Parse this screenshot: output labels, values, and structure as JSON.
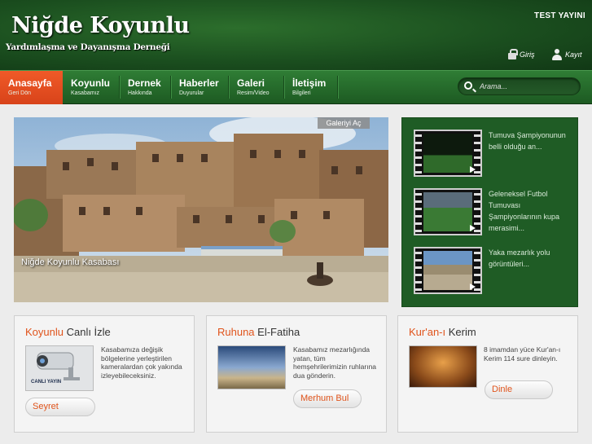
{
  "header": {
    "title": "Niğde Koyunlu",
    "subtitle": "Yardımlaşma ve Dayanışma Derneği",
    "top_right": "TEST YAYINI",
    "login_label": "Giriş",
    "register_label": "Kayıt"
  },
  "nav": {
    "items": [
      {
        "label": "Anasayfa",
        "sub": "Geri Dön"
      },
      {
        "label": "Koyunlu",
        "sub": "Kasabamız"
      },
      {
        "label": "Dernek",
        "sub": "Hakkında"
      },
      {
        "label": "Haberler",
        "sub": "Duyurular"
      },
      {
        "label": "Galeri",
        "sub": "Resim/Video"
      },
      {
        "label": "İletişim",
        "sub": "Bilgileri"
      }
    ],
    "active_index": 0,
    "search_placeholder": "Arama..."
  },
  "hero": {
    "gallery_button": "Galeriyi Aç",
    "caption": "Niğde Koyunlu Kasabası"
  },
  "videos": [
    {
      "text": "Tumuva Şampiyonunun belli olduğu an..."
    },
    {
      "text": "Geleneksel Futbol Tumuvası Şampiyonlarının kupa merasimi..."
    },
    {
      "text": "Yaka mezarlık yolu görüntüleri..."
    }
  ],
  "boxes": [
    {
      "title_accent": "Koyunlu",
      "title_rest": " Canlı İzle",
      "text": "Kasabamıza değişik bölgelerine yerleştirilen kameralardan çok yakında izleyebileceksiniz.",
      "image_label": "CANLI YAYIN",
      "button": "Seyret"
    },
    {
      "title_accent": "Ruhuna",
      "title_rest": " El-Fatiha",
      "text": "Kasabamız mezarlığında yatan, tüm hemşehrilerimizin ruhlarına dua gönderin.",
      "button": "Merhum Bul"
    },
    {
      "title_accent": "Kur'an-ı",
      "title_rest": " Kerim",
      "text": "8 imamdan yüce Kur'an-ı Kerim 114 sure dinleyin.",
      "button": "Dinle"
    }
  ],
  "colors": {
    "header_green": "#1b4f1f",
    "nav_active": "#e54d20",
    "accent_orange": "#e0541c"
  }
}
